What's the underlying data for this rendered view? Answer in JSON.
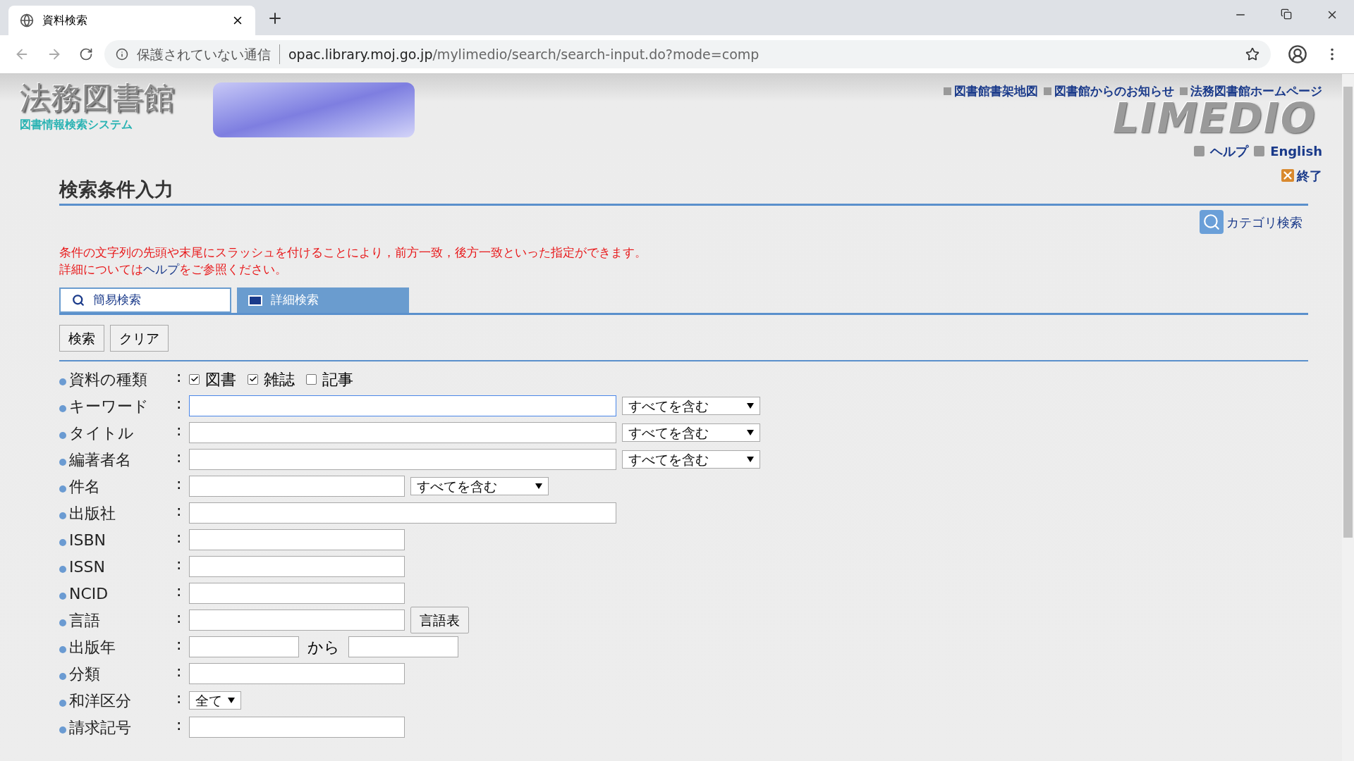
{
  "browser": {
    "tab_title": "資料検索",
    "security": "保護されていない通信",
    "url_host": "opac.library.moj.go.jp",
    "url_path": "/mylimedio/search/search-input.do?mode=comp"
  },
  "header": {
    "logo_title": "法務図書館",
    "logo_subtitle": "図書情報検索システム",
    "product_logo": "LIMEDIO",
    "links": [
      "図書館書架地図",
      "図書館からのお知らせ",
      "法務図書館ホームページ"
    ],
    "help": "ヘルプ",
    "english": "English",
    "exit": "終了"
  },
  "page": {
    "title": "検索条件入力",
    "category_search": "カテゴリ検索",
    "notice_line1": "条件の文字列の先頭や末尾にスラッシュを付けることにより，前方一致，後方一致といった指定ができます。",
    "notice_line2_before": "詳細については",
    "notice_link": "ヘルプ",
    "notice_line2_after": "をご参照ください。"
  },
  "tabs": [
    {
      "label": "簡易検索",
      "selected": false,
      "kind": "search"
    },
    {
      "label": "詳細検索",
      "selected": true,
      "kind": "list"
    }
  ],
  "buttons": [
    "検索",
    "クリア"
  ],
  "form": [
    {
      "kind": "checks",
      "label": "資料の種類",
      "colon": ":",
      "options": [
        {
          "label": "図書",
          "checked": true
        },
        {
          "label": "雑誌",
          "checked": true
        },
        {
          "label": "記事",
          "checked": false
        }
      ]
    },
    {
      "kind": "wideselect",
      "label": "キーワード",
      "colon": ":",
      "focused": true,
      "select": "すべてを含む"
    },
    {
      "kind": "wideselect",
      "label": "タイトル",
      "colon": ":",
      "focused": false,
      "select": "すべてを含む"
    },
    {
      "kind": "wideselect",
      "label": "編著者名",
      "colon": ":",
      "focused": false,
      "select": "すべてを含む"
    },
    {
      "kind": "narrowselect",
      "label": "件名",
      "colon": ":",
      "focused": false,
      "select": "すべてを含む"
    },
    {
      "kind": "wide",
      "label": "出版社",
      "colon": ":",
      "focused": false
    },
    {
      "kind": "narrow",
      "label": "ISBN",
      "colon": ":",
      "focused": false
    },
    {
      "kind": "narrow",
      "label": "ISSN",
      "colon": ":",
      "focused": false
    },
    {
      "kind": "narrow",
      "label": "NCID",
      "colon": ":",
      "focused": false
    },
    {
      "kind": "button",
      "label": "言語",
      "colon": ":",
      "focused": false,
      "button": "言語表"
    },
    {
      "kind": "range",
      "label": "出版年",
      "colon": ":",
      "focused": false,
      "between": "から"
    },
    {
      "kind": "narrow",
      "label": "分類",
      "colon": ":",
      "focused": false
    },
    {
      "kind": "select",
      "label": "和洋区分",
      "colon": ":",
      "select": "全て"
    },
    {
      "kind": "narrow",
      "label": "請求記号",
      "colon": ":",
      "focused": false
    }
  ]
}
